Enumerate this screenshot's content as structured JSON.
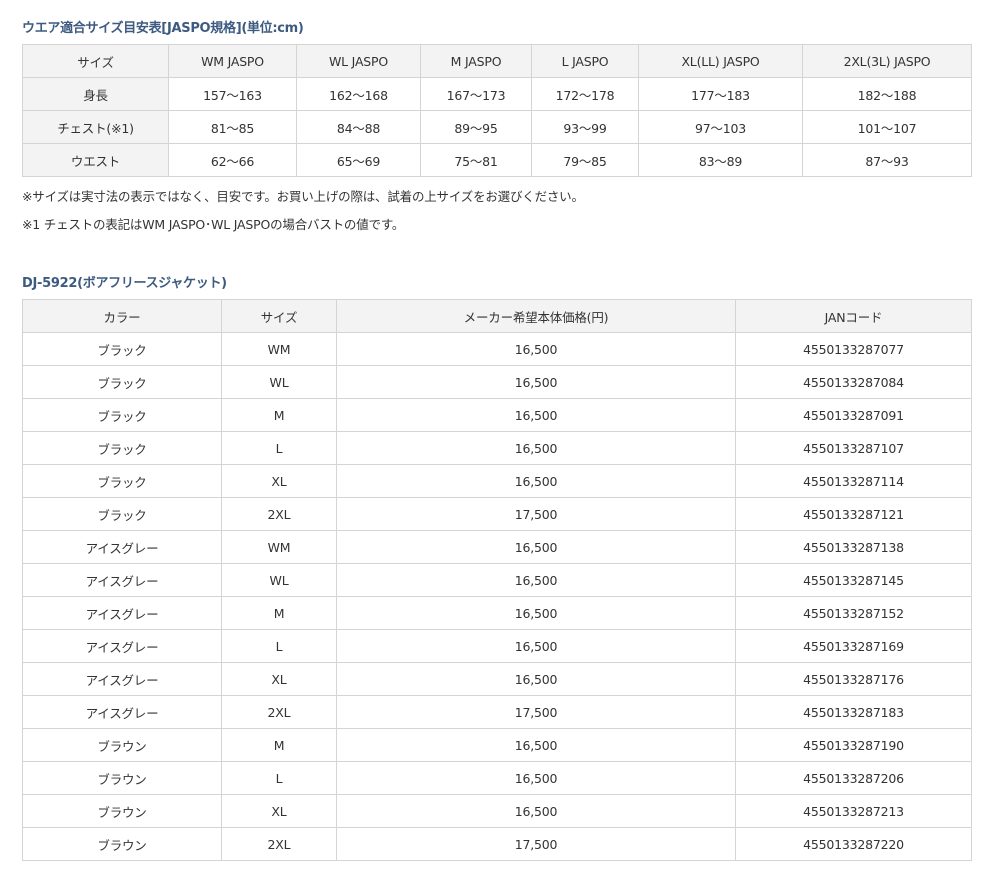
{
  "size_table": {
    "title": "ウエア適合サイズ目安表[JASPO規格](単位:cm)",
    "headers": [
      "サイズ",
      "WM JASPO",
      "WL JASPO",
      "M JASPO",
      "L JASPO",
      "XL(LL) JASPO",
      "2XL(3L) JASPO"
    ],
    "rows": [
      [
        "身長",
        "157〜163",
        "162〜168",
        "167〜173",
        "172〜178",
        "177〜183",
        "182〜188"
      ],
      [
        "チェスト(※1)",
        "81〜85",
        "84〜88",
        "89〜95",
        "93〜99",
        "97〜103",
        "101〜107"
      ],
      [
        "ウエスト",
        "62〜66",
        "65〜69",
        "75〜81",
        "79〜85",
        "83〜89",
        "87〜93"
      ]
    ],
    "notes": [
      "※サイズは実寸法の表示ではなく、目安です。お買い上げの際は、試着の上サイズをお選びください。",
      "※1 チェストの表記はWM JASPO･WL JASPOの場合バストの値です。"
    ]
  },
  "product_table": {
    "title": "DJ-5922(ボアフリースジャケット)",
    "headers": [
      "カラー",
      "サイズ",
      "メーカー希望本体価格(円)",
      "JANコード"
    ],
    "rows": [
      [
        "ブラック",
        "WM",
        "16,500",
        "4550133287077"
      ],
      [
        "ブラック",
        "WL",
        "16,500",
        "4550133287084"
      ],
      [
        "ブラック",
        "M",
        "16,500",
        "4550133287091"
      ],
      [
        "ブラック",
        "L",
        "16,500",
        "4550133287107"
      ],
      [
        "ブラック",
        "XL",
        "16,500",
        "4550133287114"
      ],
      [
        "ブラック",
        "2XL",
        "17,500",
        "4550133287121"
      ],
      [
        "アイスグレー",
        "WM",
        "16,500",
        "4550133287138"
      ],
      [
        "アイスグレー",
        "WL",
        "16,500",
        "4550133287145"
      ],
      [
        "アイスグレー",
        "M",
        "16,500",
        "4550133287152"
      ],
      [
        "アイスグレー",
        "L",
        "16,500",
        "4550133287169"
      ],
      [
        "アイスグレー",
        "XL",
        "16,500",
        "4550133287176"
      ],
      [
        "アイスグレー",
        "2XL",
        "17,500",
        "4550133287183"
      ],
      [
        "ブラウン",
        "M",
        "16,500",
        "4550133287190"
      ],
      [
        "ブラウン",
        "L",
        "16,500",
        "4550133287206"
      ],
      [
        "ブラウン",
        "XL",
        "16,500",
        "4550133287213"
      ],
      [
        "ブラウン",
        "2XL",
        "17,500",
        "4550133287220"
      ]
    ]
  }
}
